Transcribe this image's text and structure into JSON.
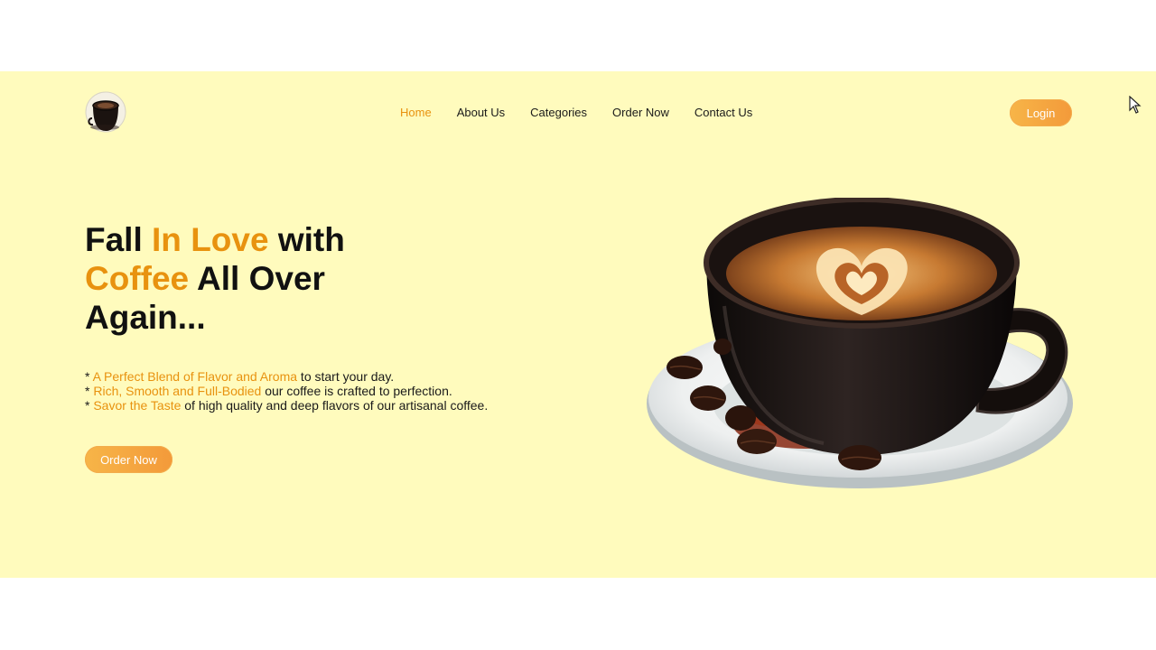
{
  "nav": {
    "items": [
      {
        "label": "Home",
        "active": true
      },
      {
        "label": "About Us"
      },
      {
        "label": "Categories"
      },
      {
        "label": "Order Now"
      },
      {
        "label": "Contact Us"
      }
    ],
    "login_label": "Login"
  },
  "hero": {
    "headline": {
      "part1": "Fall ",
      "part2": "In Love",
      "part3": " with",
      "part4": "Coffee",
      "part5": " All Over",
      "part6": "Again..."
    },
    "points": [
      {
        "prefix": "* ",
        "highlight": "A Perfect Blend of Flavor and Aroma",
        "rest": " to start your day."
      },
      {
        "prefix": "* ",
        "highlight": "Rich, Smooth and Full-Bodied",
        "rest": " our coffee is crafted to perfection."
      },
      {
        "prefix": "* ",
        "highlight": "Savor the Taste",
        "rest": " of high quality and deep flavors of our artisanal coffee."
      }
    ],
    "cta_label": "Order Now"
  },
  "colors": {
    "background": "#fffbbd",
    "accent": "#e8920f",
    "button": "#f5a841",
    "text": "#111111"
  },
  "icons": {
    "logo": "coffee-cup-logo-icon",
    "hero_image": "coffee-cup-latte-art",
    "cursor": "mouse-pointer-icon"
  }
}
